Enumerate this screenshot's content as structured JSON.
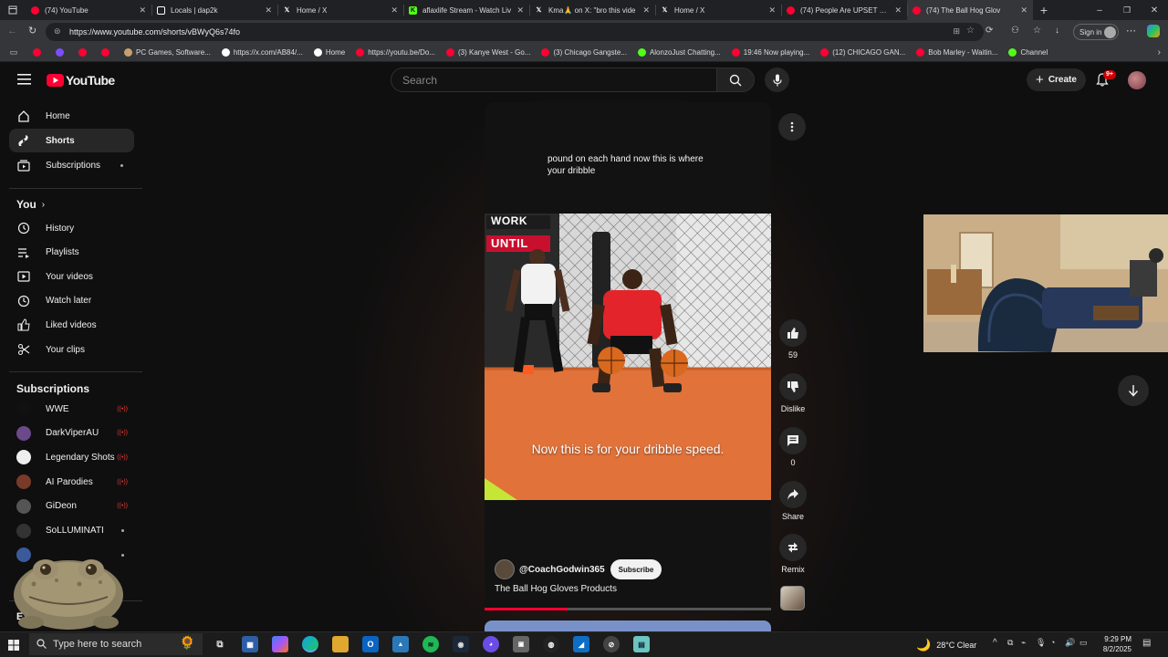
{
  "browser": {
    "tabs": [
      {
        "label": "(74) YouTube",
        "fav": "youtube",
        "color": "#ff0033"
      },
      {
        "label": "Locals | dap2k",
        "fav": "doc",
        "color": "#ffffff"
      },
      {
        "label": "Home / X",
        "fav": "x",
        "color": "#ffffff"
      },
      {
        "label": "aflaxlife Stream - Watch Liv",
        "fav": "kick",
        "color": "#53fc18"
      },
      {
        "label": "Kma🙏 on X: \"bro this vide",
        "fav": "x",
        "color": "#ffffff"
      },
      {
        "label": "Home / X",
        "fav": "x",
        "color": "#ffffff"
      },
      {
        "label": "(74) People Are UPSET With",
        "fav": "youtube",
        "color": "#ff0033"
      },
      {
        "label": "(74) The Ball Hog Glov",
        "fav": "youtube",
        "color": "#ff0033",
        "active": true
      }
    ],
    "url": "https://www.youtube.com/shorts/vBWyQ6s74fo",
    "sign_in": "Sign in",
    "bookmarks": [
      {
        "label": "",
        "color": "#ff0033"
      },
      {
        "label": "",
        "color": "#7b4dff"
      },
      {
        "label": "",
        "color": "#ff0033"
      },
      {
        "label": "",
        "color": "#ff0033"
      },
      {
        "label": "PC Games, Software...",
        "color": "#c5a26b"
      },
      {
        "label": "https://x.com/AB84/...",
        "color": "#ffffff"
      },
      {
        "label": "Home",
        "color": "#ffffff"
      },
      {
        "label": "https://youtu.be/Do...",
        "color": "#ff0033"
      },
      {
        "label": "(3) Kanye West - Go...",
        "color": "#ff0033"
      },
      {
        "label": "(3) Chicago Gangste...",
        "color": "#ff0033"
      },
      {
        "label": "AlonzoJust Chatting...",
        "color": "#53fc18"
      },
      {
        "label": "19:46 Now playing...",
        "color": "#ff0033"
      },
      {
        "label": "(12) CHICAGO GAN...",
        "color": "#ff0033"
      },
      {
        "label": "Bob Marley - Waitin...",
        "color": "#ff0033"
      },
      {
        "label": "Channel",
        "color": "#53fc18"
      }
    ]
  },
  "youtube": {
    "logo_text": "YouTube",
    "search_placeholder": "Search",
    "create_label": "Create",
    "notif_badge": "9+",
    "sidebar": {
      "main": [
        {
          "label": "Home",
          "icon": "home-icon"
        },
        {
          "label": "Shorts",
          "icon": "shorts-icon",
          "active": true
        },
        {
          "label": "Subscriptions",
          "icon": "subscriptions-icon"
        }
      ],
      "you_heading": "You",
      "you": [
        {
          "label": "History",
          "icon": "history-icon"
        },
        {
          "label": "Playlists",
          "icon": "playlists-icon"
        },
        {
          "label": "Your videos",
          "icon": "your-videos-icon"
        },
        {
          "label": "Watch later",
          "icon": "watch-later-icon"
        },
        {
          "label": "Liked videos",
          "icon": "liked-videos-icon"
        },
        {
          "label": "Your clips",
          "icon": "clips-icon"
        }
      ],
      "subs_heading": "Subscriptions",
      "subscriptions": [
        {
          "label": "WWE",
          "color": "#111111",
          "status": "live"
        },
        {
          "label": "DarkViperAU",
          "color": "#6a4a8a",
          "status": "live"
        },
        {
          "label": "Legendary Shots",
          "color": "#eeeeee",
          "status": "live"
        },
        {
          "label": "AI Parodies",
          "color": "#7a3a2a",
          "status": "live"
        },
        {
          "label": "GiDeon",
          "color": "#555555",
          "status": "live"
        },
        {
          "label": "SoLLUMINATI",
          "color": "#333333",
          "status": "dot"
        },
        {
          "label": "",
          "color": "#3a5a9a",
          "status": "dot"
        }
      ],
      "explore_partial": "Exp"
    },
    "short": {
      "top_caption": "pound on each hand now this is where your dribble",
      "sign_text_1": "WORK",
      "sign_text_2": "UNTIL",
      "overlay_caption": "Now this is for your dribble speed.",
      "channel": "@CoachGodwin365",
      "subscribe_label": "Subscribe",
      "title": "The Ball Hog Gloves Products",
      "progress": 0.29,
      "actions": {
        "likes": "59",
        "dislike_label": "Dislike",
        "comments": "0",
        "share_label": "Share",
        "remix_label": "Remix"
      }
    }
  },
  "taskbar": {
    "search_placeholder": "Type here to search",
    "weather": "28°C  Clear",
    "time": "9:29 PM",
    "date": "8/2/2025"
  }
}
